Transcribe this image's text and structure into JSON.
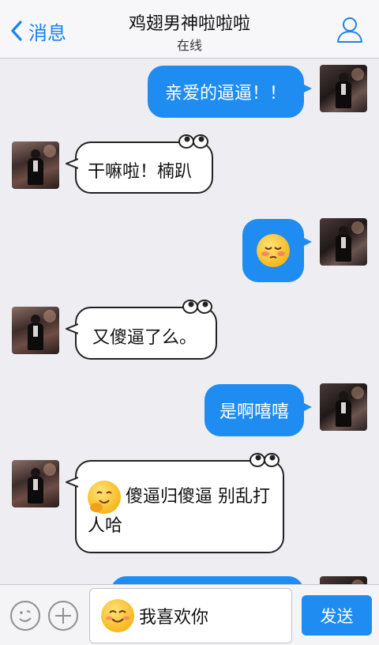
{
  "header": {
    "back_label": "消息",
    "title": "鸡翅男神啦啦啦",
    "status": "在线"
  },
  "messages": [
    {
      "side": "right",
      "text": "亲爱的逼逼！！"
    },
    {
      "side": "left",
      "text": "干嘛啦！楠趴"
    },
    {
      "side": "right",
      "text": "",
      "icon": "blushing-face-emoji-icon"
    },
    {
      "side": "left",
      "text": "又傻逼了么。"
    },
    {
      "side": "right",
      "text": "是啊嘻嘻"
    },
    {
      "side": "left",
      "text": "傻逼归傻逼 别乱打人哈",
      "icon": "hugging-face-emoji-icon"
    }
  ],
  "input": {
    "value": "我喜欢你",
    "send_label": "发送"
  },
  "colors": {
    "accent": "#1e8cf0",
    "background": "#ededf2"
  }
}
